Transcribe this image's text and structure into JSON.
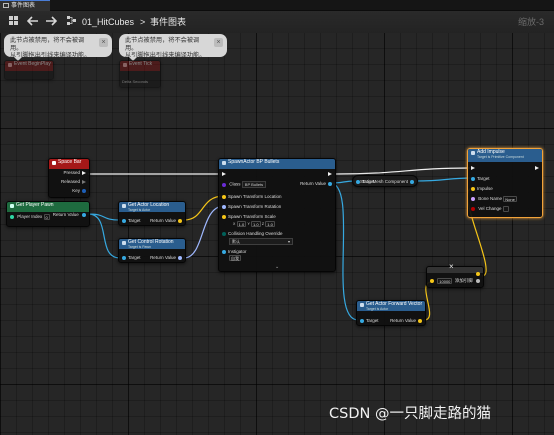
{
  "tab": {
    "title": "事件图表"
  },
  "toolbar": {
    "breadcrumb_project": "01_HitCubes",
    "breadcrumb_sep": ">",
    "breadcrumb_graph": "事件图表",
    "zoom": "缩放-3"
  },
  "comments": [
    {
      "line1": "此节点被禁用，将不会被调用。",
      "line2": "从引脚拖出引线来编译功能。",
      "close": "×"
    },
    {
      "line1": "此节点被禁用，将不会被调用。",
      "line2": "从引脚拖出引线来编译功能。",
      "close": "×"
    }
  ],
  "disabled_nodes": [
    {
      "title": "Event BeginPlay"
    },
    {
      "title": "Event Tick",
      "pin": "Delta Seconds"
    }
  ],
  "space_bar": {
    "title": "Space Bar",
    "pins": [
      "Pressed",
      "Released",
      "Key"
    ]
  },
  "get_player_pawn": {
    "title": "Get Player Pawn",
    "pin": "Player Index",
    "index": "0",
    "out": "Return Value"
  },
  "get_actor_location": {
    "title": "Get Actor Location",
    "subtitle": "Target is Actor",
    "in": "Target",
    "out": "Return Value"
  },
  "get_control_rotation": {
    "title": "Get Control Rotation",
    "subtitle": "Target is Pawn",
    "in": "Target",
    "out": "Return Value"
  },
  "spawn_actor": {
    "title": "SpawnActor BP Bullets",
    "class_label": "Class",
    "class_value": "BP Bullets",
    "out": "Return Value",
    "pins": [
      "Spawn Transform Location",
      "Spawn Transform Rotation",
      "Spawn Transform Scale"
    ],
    "scale": [
      "1.0",
      "1.0",
      "1.0"
    ],
    "collision_label": "Collision Handling Override",
    "collision_value": "默认",
    "instigator_label": "Instigator",
    "instigator_value": "自我"
  },
  "static_mesh": {
    "in": "Target",
    "label": "Static Mesh Component"
  },
  "add_impulse": {
    "title": "Add Impulse",
    "subtitle": "Target is Primitive Component",
    "pins": [
      "Target",
      "Impulse",
      "Bone Name",
      "Vel Change"
    ],
    "bone_value": "None"
  },
  "get_forward_vector": {
    "title": "Get Actor Forward Vector",
    "subtitle": "Target is Actor",
    "in": "Target",
    "out": "Return Value"
  },
  "multiply": {
    "value": "10000",
    "add_pin": "添加引脚",
    "op": "×"
  },
  "watermark": {
    "text": "CSDN @一只脚走路的猫"
  },
  "colors": {
    "exec": "#f0f0f0",
    "object": "#36a9e1",
    "vector": "#f5c518",
    "rotator": "#9fb8ff",
    "selection": "#f2a33a"
  },
  "icons": [
    "blueprint-icon",
    "back-arrow-icon",
    "forward-arrow-icon",
    "graph-icon",
    "grid-icon"
  ]
}
